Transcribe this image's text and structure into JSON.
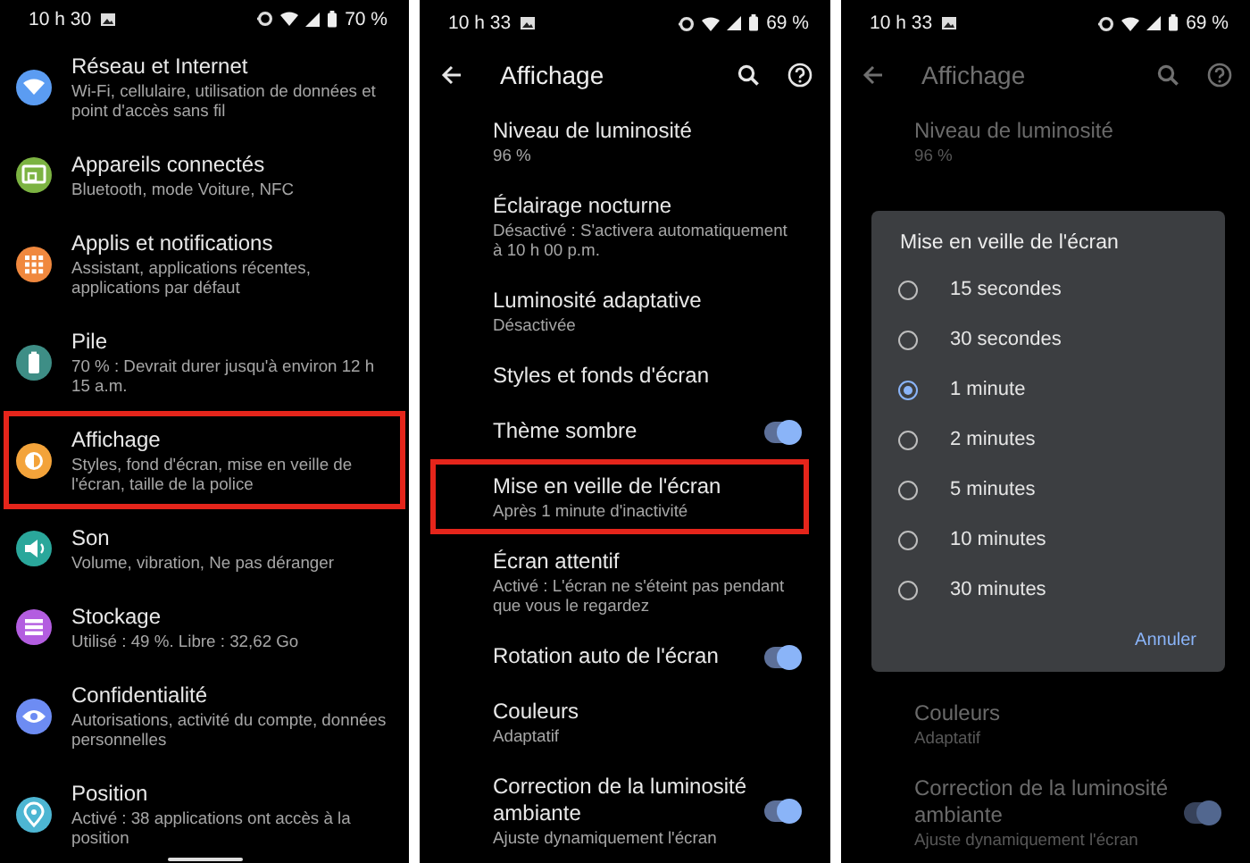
{
  "screens": [
    {
      "status_bar": {
        "time": "10 h 30",
        "battery": "70 %"
      },
      "items": [
        {
          "title": "Réseau et Internet",
          "subtitle": "Wi-Fi, cellulaire, utilisation de données et point d'accès sans fil",
          "color": "#5b9cf2",
          "highlighted": false
        },
        {
          "title": "Appareils connectés",
          "subtitle": "Bluetooth, mode Voiture, NFC",
          "color": "#7cb342",
          "highlighted": false
        },
        {
          "title": "Applis et notifications",
          "subtitle": "Assistant, applications récentes, applications par défaut",
          "color": "#f0883e",
          "highlighted": false
        },
        {
          "title": "Pile",
          "subtitle": "70 % : Devrait durer jusqu'à environ 12 h 15 a.m.",
          "color": "#3e8e86",
          "highlighted": false
        },
        {
          "title": "Affichage",
          "subtitle": "Styles, fond d'écran, mise en veille de l'écran, taille de la police",
          "color": "#f3a33a",
          "highlighted": true
        },
        {
          "title": "Son",
          "subtitle": "Volume, vibration, Ne pas déranger",
          "color": "#2aa79b",
          "highlighted": false
        },
        {
          "title": "Stockage",
          "subtitle": "Utilisé : 49 %. Libre : 32,62 Go",
          "color": "#b35de0",
          "highlighted": false
        },
        {
          "title": "Confidentialité",
          "subtitle": "Autorisations, activité du compte, données personnelles",
          "color": "#6d8cf3",
          "highlighted": false
        },
        {
          "title": "Position",
          "subtitle": "Activé : 38 applications ont accès à la position",
          "color": "#4db6d3",
          "highlighted": false
        }
      ]
    },
    {
      "status_bar": {
        "time": "10 h 33",
        "battery": "69 %"
      },
      "toolbar": {
        "title": "Affichage"
      },
      "items": [
        {
          "kind": "text",
          "title": "Niveau de luminosité",
          "subtitle": "96 %",
          "highlighted": false
        },
        {
          "kind": "text",
          "title": "Éclairage nocturne",
          "subtitle": "Désactivé : S'activera automatiquement à 10 h 00 p.m.",
          "highlighted": false
        },
        {
          "kind": "text",
          "title": "Luminosité adaptative",
          "subtitle": "Désactivée",
          "highlighted": false
        },
        {
          "kind": "text",
          "title": "Styles et fonds d'écran",
          "highlighted": false
        },
        {
          "kind": "toggle",
          "title": "Thème sombre",
          "on": true,
          "highlighted": false
        },
        {
          "kind": "text",
          "title": "Mise en veille de l'écran",
          "subtitle": "Après 1 minute d'inactivité",
          "highlighted": true
        },
        {
          "kind": "text",
          "title": "Écran attentif",
          "subtitle": "Activé : L'écran ne s'éteint pas pendant que vous le regardez",
          "highlighted": false
        },
        {
          "kind": "toggle",
          "title": "Rotation auto de l'écran",
          "on": true,
          "highlighted": false
        },
        {
          "kind": "text",
          "title": "Couleurs",
          "subtitle": "Adaptatif",
          "highlighted": false
        },
        {
          "kind": "toggle",
          "title": "Correction de la luminosité ambiante",
          "subtitle": "Ajuste dynamiquement l'écran",
          "on": true,
          "highlighted": false
        }
      ]
    },
    {
      "status_bar": {
        "time": "10 h 33",
        "battery": "69 %"
      },
      "toolbar": {
        "title": "Affichage"
      },
      "items": [
        {
          "kind": "text",
          "title": "Niveau de luminosité",
          "subtitle": "96 %",
          "highlighted": false
        },
        {
          "kind": "text",
          "title": "Couleurs",
          "subtitle": "Adaptatif",
          "highlighted": false
        },
        {
          "kind": "toggle",
          "title": "Correction de la luminosité ambiante",
          "subtitle": "Ajuste dynamiquement l'écran",
          "on": true,
          "highlighted": false
        }
      ],
      "dialog": {
        "title": "Mise en veille de l'écran",
        "options": [
          {
            "label": "15 secondes",
            "selected": false
          },
          {
            "label": "30 secondes",
            "selected": false
          },
          {
            "label": "1 minute",
            "selected": true
          },
          {
            "label": "2 minutes",
            "selected": false
          },
          {
            "label": "5 minutes",
            "selected": false
          },
          {
            "label": "10 minutes",
            "selected": false
          },
          {
            "label": "30 minutes",
            "selected": false
          }
        ],
        "cancel": "Annuler"
      }
    }
  ]
}
